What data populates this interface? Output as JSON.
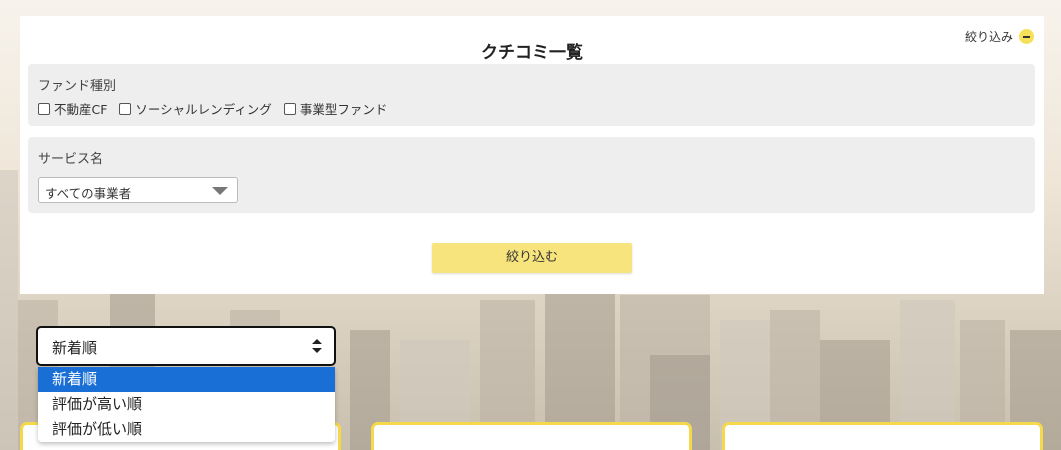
{
  "panel": {
    "title": "クチコミ一覧",
    "narrow_toggle_label": "絞り込み"
  },
  "fund_type": {
    "label": "ファンド種別",
    "options": [
      "不動産CF",
      "ソーシャルレンディング",
      "事業型ファンド"
    ],
    "checked": [
      false,
      false,
      false
    ]
  },
  "service": {
    "label": "サービス名",
    "selected": "すべての事業者"
  },
  "apply_button": "絞り込む",
  "sort": {
    "selected": "新着順",
    "options": [
      "新着順",
      "評価が高い順",
      "評価が低い順"
    ],
    "highlighted_index": 0
  },
  "colors": {
    "accent_yellow": "#f7e47d",
    "card_border": "#f6d94a",
    "dropdown_highlight": "#1a6fd6"
  }
}
